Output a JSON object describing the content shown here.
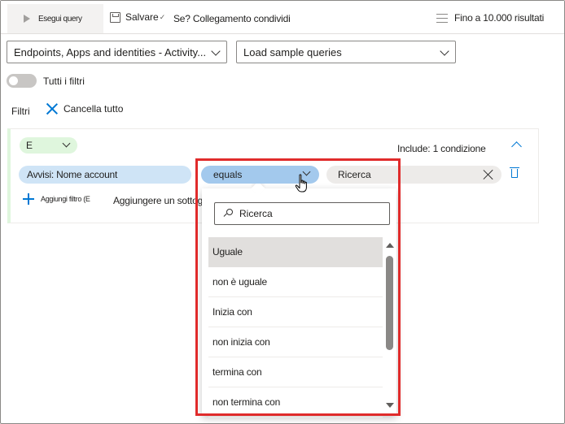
{
  "toolbar": {
    "run_query": "Esegui query",
    "save": "Salvare",
    "share_link": "Se? Collegamento condividi",
    "results_limit": "Fino a 10.000 risultati"
  },
  "schema_dropdown": {
    "value": "Endpoints, Apps and identities - Activity..."
  },
  "sample_dropdown": {
    "value": "Load sample queries"
  },
  "filters_toggle": {
    "label": "Tutti i filtri",
    "on": false
  },
  "filters": {
    "header": "Filtri",
    "clear_all": "Cancella tutto",
    "group": {
      "operator": "E",
      "include": "Include: 1 condizione",
      "field": "Avvisi: Nome account",
      "condition": "equals",
      "value_placeholder": "Ricerca",
      "add_filter": "Aggiungi filtro (E",
      "add_subgroup": "Aggiungere un sottogruppo"
    }
  },
  "condition_menu": {
    "search_placeholder": "Ricerca",
    "options": [
      {
        "label": "Uguale",
        "selected": true
      },
      {
        "label": "non è uguale",
        "selected": false
      },
      {
        "label": "Inizia con",
        "selected": false
      },
      {
        "label": "non inizia con",
        "selected": false
      },
      {
        "label": "termina con",
        "selected": false
      },
      {
        "label": "non termina con",
        "selected": false
      }
    ]
  },
  "colors": {
    "accent": "#0078d4",
    "highlight_border": "#e02b2b",
    "field_pill": "#cfe4f6",
    "condition_pill": "#a3c9ed",
    "operator_pill": "#dff6dd"
  }
}
